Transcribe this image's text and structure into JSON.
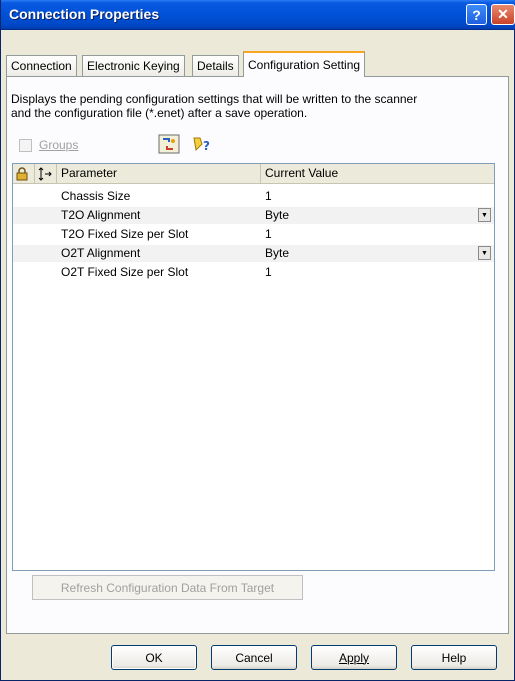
{
  "window": {
    "title": "Connection Properties",
    "help_icon": "question-icon",
    "close_icon": "close-icon"
  },
  "tabs": [
    {
      "label": "Connection",
      "active": false
    },
    {
      "label": "Electronic Keying",
      "active": false
    },
    {
      "label": "Details",
      "active": false
    },
    {
      "label": "Configuration Setting",
      "active": true
    }
  ],
  "panel": {
    "description_line1": "Displays the pending configuration settings that will be written to the scanner",
    "description_line2": "and the configuration file (*.enet)  after a save operation.",
    "groups_label": "Groups",
    "groups_checked": false,
    "toolbar_icons": [
      "sort-icon",
      "help-icon"
    ]
  },
  "list": {
    "header_icons": [
      "lock-icon",
      "sort-arrows-icon"
    ],
    "columns": [
      "Parameter",
      "Current Value"
    ],
    "rows": [
      {
        "parameter": "Chassis Size",
        "value": "1",
        "has_dropdown": false
      },
      {
        "parameter": "T2O Alignment",
        "value": "Byte",
        "has_dropdown": true
      },
      {
        "parameter": "T2O Fixed Size per Slot",
        "value": "1",
        "has_dropdown": false
      },
      {
        "parameter": "O2T Alignment",
        "value": "Byte",
        "has_dropdown": true
      },
      {
        "parameter": "O2T Fixed Size per Slot",
        "value": "1",
        "has_dropdown": false
      }
    ]
  },
  "refresh_button": "Refresh Configuration Data From Target",
  "buttons": {
    "ok": "OK",
    "cancel": "Cancel",
    "apply": "Apply",
    "help": "Help"
  },
  "colors": {
    "titlebar": "#0051d8",
    "active_tab_accent": "#f5a623",
    "dialog_bg": "#ece9d8"
  }
}
